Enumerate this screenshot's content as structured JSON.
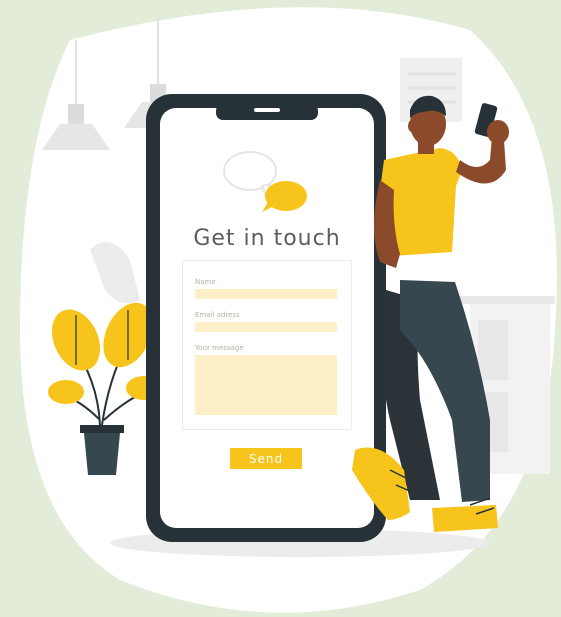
{
  "form": {
    "title": "Get in touch",
    "fields": [
      {
        "label": "Name",
        "value": ""
      },
      {
        "label": "Email adress",
        "value": ""
      },
      {
        "label": "Your message",
        "value": ""
      }
    ],
    "send_label": "Send"
  },
  "colors": {
    "background": "#e2ecd9",
    "phone_frame": "#263238",
    "accent_yellow": "#f7c41b",
    "field_fill": "#fdf0c8",
    "skin": "#8b4a2a"
  },
  "icons": [
    "chat-bubbles-icon",
    "plant-icon",
    "lamp-icon"
  ]
}
